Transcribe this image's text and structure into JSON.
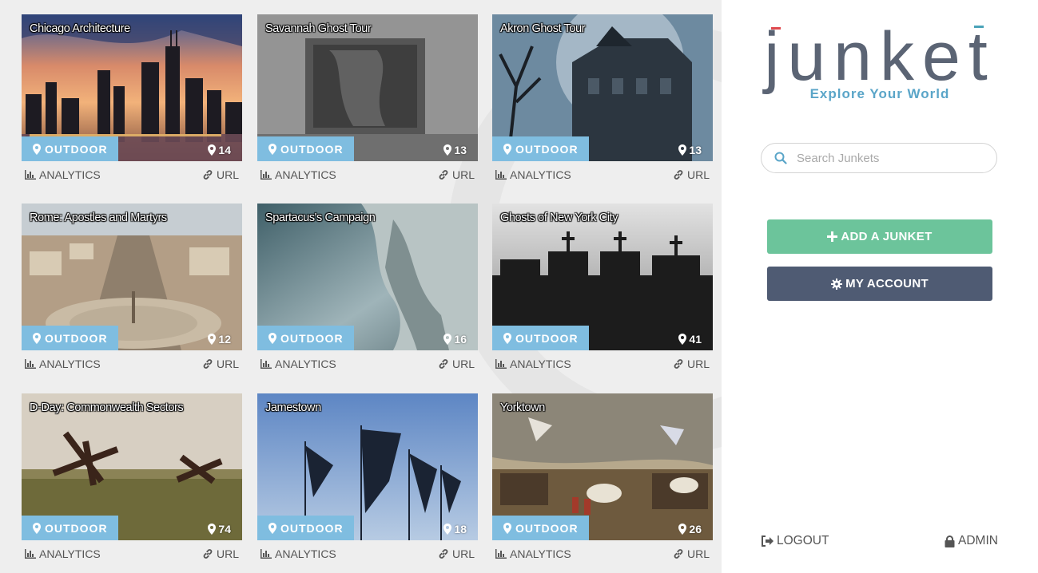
{
  "cards": [
    {
      "title": "Chicago Architecture",
      "category": "OUTDOOR",
      "count": "14",
      "analytics": "ANALYTICS",
      "url": "URL"
    },
    {
      "title": "Savannah Ghost Tour",
      "category": "OUTDOOR",
      "count": "13",
      "analytics": "ANALYTICS",
      "url": "URL"
    },
    {
      "title": "Akron Ghost Tour",
      "category": "OUTDOOR",
      "count": "13",
      "analytics": "ANALYTICS",
      "url": "URL"
    },
    {
      "title": "Rome: Apostles and Martyrs",
      "category": "OUTDOOR",
      "count": "12",
      "analytics": "ANALYTICS",
      "url": "URL"
    },
    {
      "title": "Spartacus's Campaign",
      "category": "OUTDOOR",
      "count": "16",
      "analytics": "ANALYTICS",
      "url": "URL"
    },
    {
      "title": "Ghosts of New York City",
      "category": "OUTDOOR",
      "count": "41",
      "analytics": "ANALYTICS",
      "url": "URL"
    },
    {
      "title": "D-Day: Commonwealth Sectors",
      "category": "OUTDOOR",
      "count": "74",
      "analytics": "ANALYTICS",
      "url": "URL"
    },
    {
      "title": "Jamestown",
      "category": "OUTDOOR",
      "count": "18",
      "analytics": "ANALYTICS",
      "url": "URL"
    },
    {
      "title": "Yorktown",
      "category": "OUTDOOR",
      "count": "26",
      "analytics": "ANALYTICS",
      "url": "URL"
    }
  ],
  "sidebar": {
    "logo_text": "junket",
    "tagline": "Explore Your World",
    "search_placeholder": "Search Junkets",
    "add_label": "ADD A JUNKET",
    "account_label": "MY ACCOUNT",
    "logout_label": "LOGOUT",
    "admin_label": "ADMIN"
  },
  "colors": {
    "badge": "#7fbde0",
    "add_button": "#6cc49b",
    "account_button": "#4f5b73",
    "logo_red": "#e04a4f",
    "logo_teal": "#4aa3b8",
    "logo_slate": "#5b6474"
  },
  "icons": {
    "badge": "map-marker-icon",
    "count": "map-marker-icon",
    "analytics": "bar-chart-icon",
    "url": "link-icon",
    "search": "search-icon",
    "add": "plus-icon",
    "account": "gear-icon",
    "logout": "sign-out-icon",
    "admin": "lock-icon"
  }
}
